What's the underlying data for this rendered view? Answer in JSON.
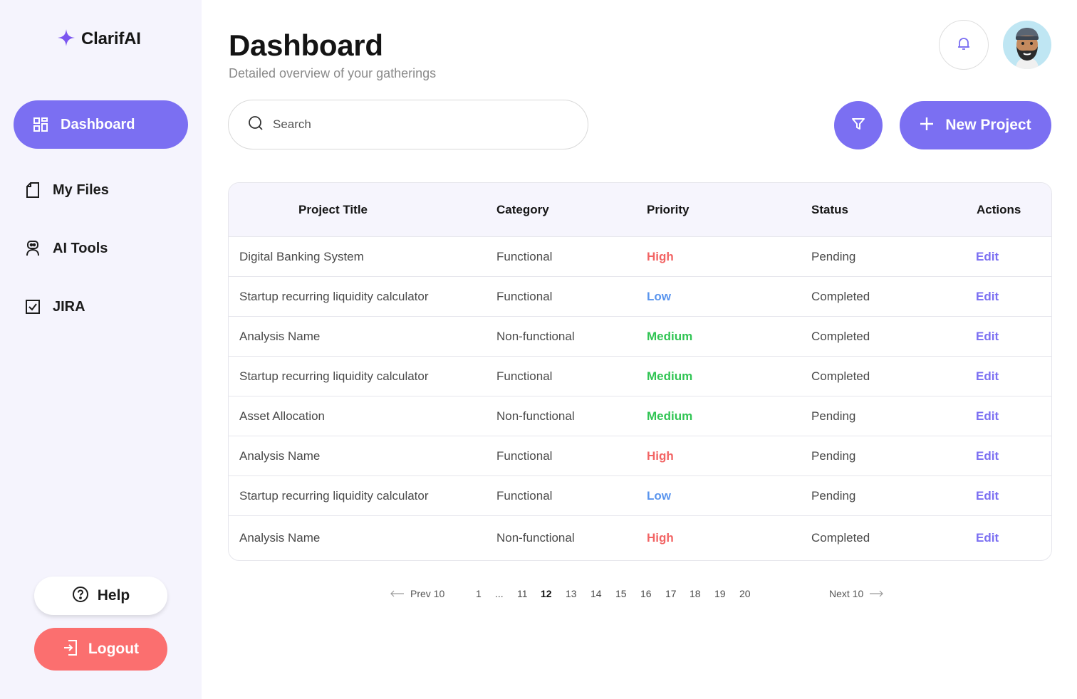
{
  "app": {
    "name": "ClarifAI"
  },
  "sidebar": {
    "items": [
      {
        "label": "Dashboard",
        "icon": "grid-icon",
        "active": true
      },
      {
        "label": "My Files",
        "icon": "file-icon"
      },
      {
        "label": "AI Tools",
        "icon": "robot-icon"
      },
      {
        "label": "JIRA",
        "icon": "checkbox-icon"
      }
    ],
    "help_label": "Help",
    "logout_label": "Logout"
  },
  "header": {
    "title": "Dashboard",
    "subtitle": "Detailed overview of your gatherings"
  },
  "search": {
    "placeholder": "Search"
  },
  "actions": {
    "new_project_label": "New Project"
  },
  "colors": {
    "accent": "#7b6ff2",
    "high": "#f26464",
    "low": "#5a95ee",
    "medium": "#31c554",
    "logout": "#fb6f6f"
  },
  "table": {
    "headers": [
      "Project Title",
      "Category",
      "Priority",
      "Status",
      "Actions"
    ],
    "rows": [
      {
        "title": "Digital Banking System",
        "category": "Functional",
        "priority": "High",
        "status": "Pending",
        "action": "Edit"
      },
      {
        "title": "Startup recurring liquidity calculator",
        "category": "Functional",
        "priority": "Low",
        "status": "Completed",
        "action": "Edit"
      },
      {
        "title": "Analysis Name",
        "category": "Non-functional",
        "priority": "Medium",
        "status": "Completed",
        "action": "Edit"
      },
      {
        "title": "Startup recurring liquidity calculator",
        "category": "Functional",
        "priority": "Medium",
        "status": "Completed",
        "action": "Edit"
      },
      {
        "title": "Asset Allocation",
        "category": "Non-functional",
        "priority": "Medium",
        "status": "Pending",
        "action": "Edit"
      },
      {
        "title": "Analysis Name",
        "category": "Functional",
        "priority": "High",
        "status": "Pending",
        "action": "Edit"
      },
      {
        "title": "Startup recurring liquidity calculator",
        "category": "Functional",
        "priority": "Low",
        "status": "Pending",
        "action": "Edit"
      },
      {
        "title": "Analysis Name",
        "category": "Non-functional",
        "priority": "High",
        "status": "Completed",
        "action": "Edit"
      }
    ]
  },
  "pagination": {
    "prev_label": "Prev 10",
    "next_label": "Next 10",
    "pages": [
      "1",
      "...",
      "11",
      "12",
      "13",
      "14",
      "15",
      "16",
      "17",
      "18",
      "19",
      "20"
    ],
    "current": "12"
  }
}
